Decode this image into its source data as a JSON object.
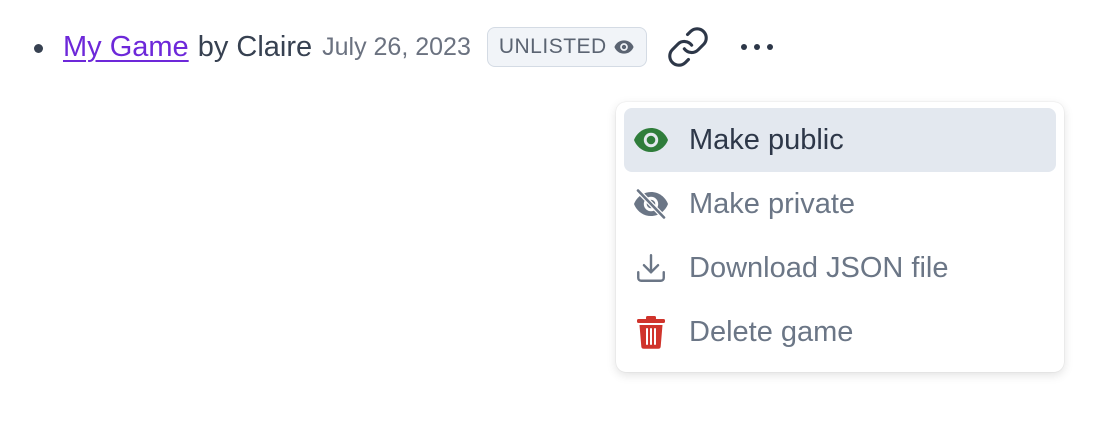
{
  "game": {
    "title": "My Game",
    "byline": "by Claire",
    "date": "July 26, 2023",
    "visibility_badge": "UNLISTED",
    "badge_icon": "eye-icon",
    "share_icon": "link-icon",
    "more_icon": "more-horizontal-icon"
  },
  "menu": {
    "items": [
      {
        "label": "Make public",
        "icon": "eye-icon",
        "icon_color": "#2f7d3b",
        "highlighted": true
      },
      {
        "label": "Make private",
        "icon": "eye-off-icon",
        "icon_color": "#6b7686",
        "highlighted": false
      },
      {
        "label": "Download JSON file",
        "icon": "download-icon",
        "icon_color": "#6b7686",
        "highlighted": false
      },
      {
        "label": "Delete game",
        "icon": "trash-icon",
        "icon_color": "#d0342c",
        "highlighted": false
      }
    ]
  },
  "colors": {
    "link": "#6d28d9",
    "text": "#374151",
    "muted": "#6b7280",
    "highlight_bg": "#e3e8ef",
    "danger": "#d0342c",
    "success": "#2f7d3b"
  }
}
